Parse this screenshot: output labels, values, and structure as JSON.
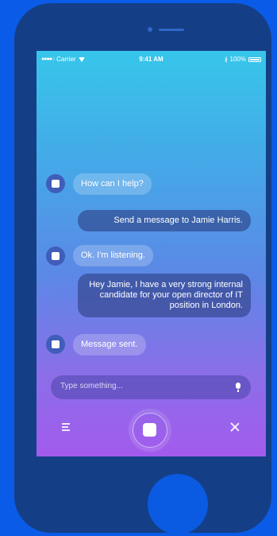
{
  "status_bar": {
    "signal": "●●●●○",
    "carrier": "Carrier",
    "time": "9:41 AM",
    "bluetooth": "∦",
    "battery_percent": "100%",
    "wifi_icon": "wifi-icon",
    "battery_icon": "battery-icon"
  },
  "chat": {
    "messages": [
      {
        "sender": "assistant",
        "text": "How can I help?"
      },
      {
        "sender": "user",
        "text": "Send a message to Jamie Harris."
      },
      {
        "sender": "assistant",
        "text": "Ok. I'm listening."
      },
      {
        "sender": "user",
        "text": "Hey Jamie, I have a very strong internal candidate for your open director of IT position in London."
      },
      {
        "sender": "assistant",
        "text": "Message sent."
      }
    ]
  },
  "input": {
    "placeholder": "Type something..."
  },
  "controls": {
    "menu_icon": "menu-icon",
    "record_icon": "record-button",
    "close_icon": "close-icon"
  },
  "colors": {
    "background": "#0a5ce8",
    "phone_body": "#143f86",
    "gradient_top": "#37c6ea",
    "gradient_bottom": "#a35bed"
  }
}
